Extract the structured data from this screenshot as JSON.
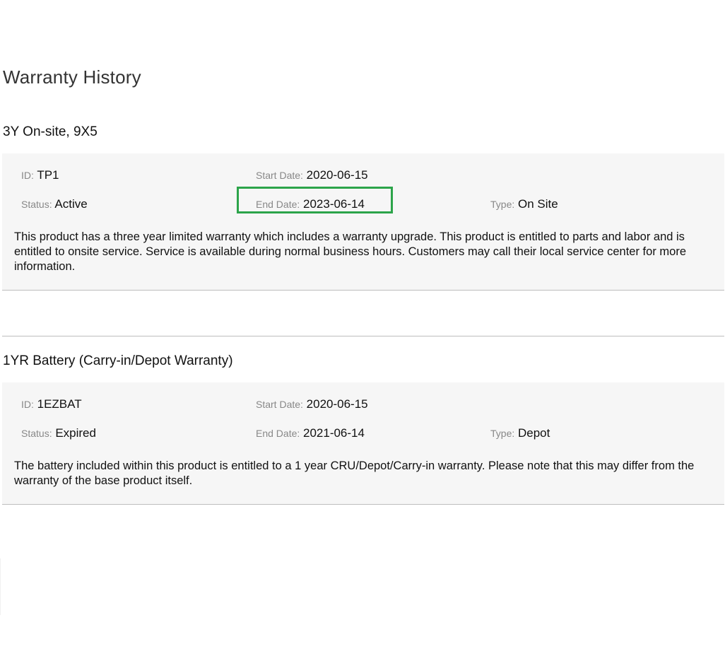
{
  "page": {
    "title": "Warranty History"
  },
  "labels": {
    "id": "ID:",
    "start_date": "Start Date:",
    "status": "Status:",
    "end_date": "End Date:",
    "type": "Type:"
  },
  "warranties": [
    {
      "name": "3Y On-site, 9X5",
      "id": "TP1",
      "start_date": "2020-06-15",
      "status": "Active",
      "end_date": "2023-06-14",
      "type": "On Site",
      "description": "This product has a three year limited warranty which includes a warranty upgrade. This product is entitled to parts and labor and is entitled to onsite service. Service is available during normal business hours. Customers may call their local service center for more information.",
      "end_date_highlighted": true
    },
    {
      "name": "1YR Battery (Carry-in/Depot Warranty)",
      "id": "1EZBAT",
      "start_date": "2020-06-15",
      "status": "Expired",
      "end_date": "2021-06-14",
      "type": "Depot",
      "description": "The battery included within this product is entitled to a 1 year CRU/Depot/Carry-in warranty. Please note that this may differ from the warranty of the base product itself.",
      "end_date_highlighted": false
    }
  ],
  "colors": {
    "highlight": "#2ca44a",
    "card_background": "#f6f6f6",
    "label_gray": "#888888"
  }
}
